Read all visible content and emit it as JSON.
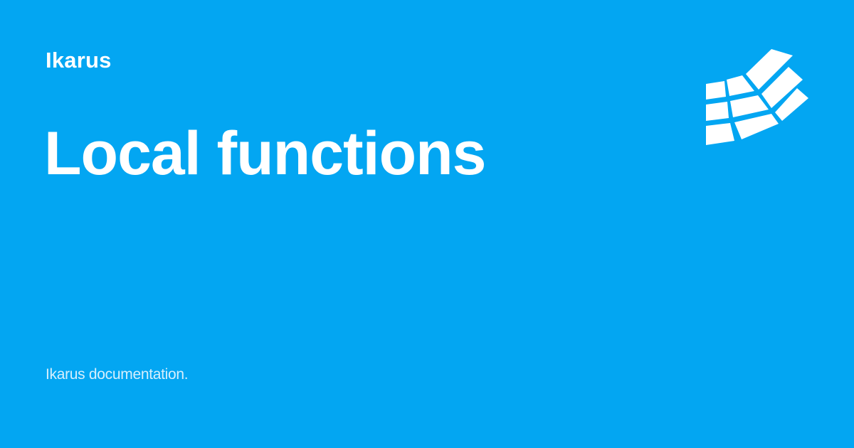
{
  "site": {
    "name": "Ikarus"
  },
  "page": {
    "title": "Local functions",
    "description": "Ikarus documentation."
  },
  "logo": {
    "icon": "ikarus-wing-grid-icon"
  },
  "colors": {
    "background": "#03a6f2",
    "text": "#ffffff"
  }
}
